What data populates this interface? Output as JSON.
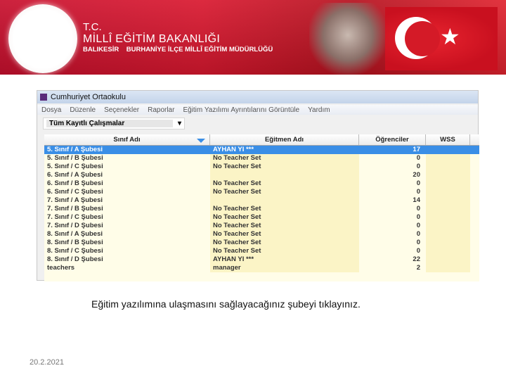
{
  "banner": {
    "line1": "T.C.",
    "line2": "MİLLÎ EĞİTİM BAKANLIĞI",
    "line3": "BALIKESİR    BURHANİYE İLÇE MİLLÎ EĞİTİM MÜDÜRLÜĞÜ",
    "logo_text": "T.C. MİLLÎ EĞİTİM BAKANLIĞI"
  },
  "window": {
    "title": "Cumhuriyet Ortaokulu",
    "menu": [
      "Dosya",
      "Düzenle",
      "Seçenekler",
      "Raporlar",
      "Eğitim Yazılımı Ayrıntılarını Görüntüle",
      "Yardım"
    ],
    "dropdown": "Tüm Kayıtlı Çalışmalar",
    "columns": [
      "Sınıf Adı",
      "Eğitmen Adı",
      "Öğrenciler",
      "WSS"
    ],
    "rows": [
      [
        "5. Sınıf / A Şubesi",
        "AYHAN YI ***",
        "17",
        ""
      ],
      [
        "5. Sınıf / B Şubesi",
        "No Teacher Set",
        "0",
        ""
      ],
      [
        "5. Sınıf / C Şubesi",
        "No Teacher Set",
        "0",
        ""
      ],
      [
        "6. Sınıf / A Şubesi",
        "",
        "20",
        ""
      ],
      [
        "6. Sınıf / B Şubesi",
        "No Teacher Set",
        "0",
        ""
      ],
      [
        "6. Sınıf / C Şubesi",
        "No Teacher Set",
        "0",
        ""
      ],
      [
        "7. Sınıf / A Şubesi",
        "",
        "14",
        ""
      ],
      [
        "7. Sınıf / B Şubesi",
        "No Teacher Set",
        "0",
        ""
      ],
      [
        "7. Sınıf / C Şubesi",
        "No Teacher Set",
        "0",
        ""
      ],
      [
        "7. Sınıf / D Şubesi",
        "No Teacher Set",
        "0",
        ""
      ],
      [
        "8. Sınıf / A Şubesi",
        "No Teacher Set",
        "0",
        ""
      ],
      [
        "8. Sınıf / B Şubesi",
        "No Teacher Set",
        "0",
        ""
      ],
      [
        "8. Sınıf / C Şubesi",
        "No Teacher Set",
        "0",
        ""
      ],
      [
        "8. Sınıf / D Şubesi",
        "AYHAN YI ***",
        "22",
        ""
      ],
      [
        "teachers",
        "manager",
        "2",
        ""
      ]
    ]
  },
  "caption": "Eğitim yazılımına ulaşmasını sağlayacağınız şubeyi tıklayınız.",
  "date": "20.2.2021"
}
